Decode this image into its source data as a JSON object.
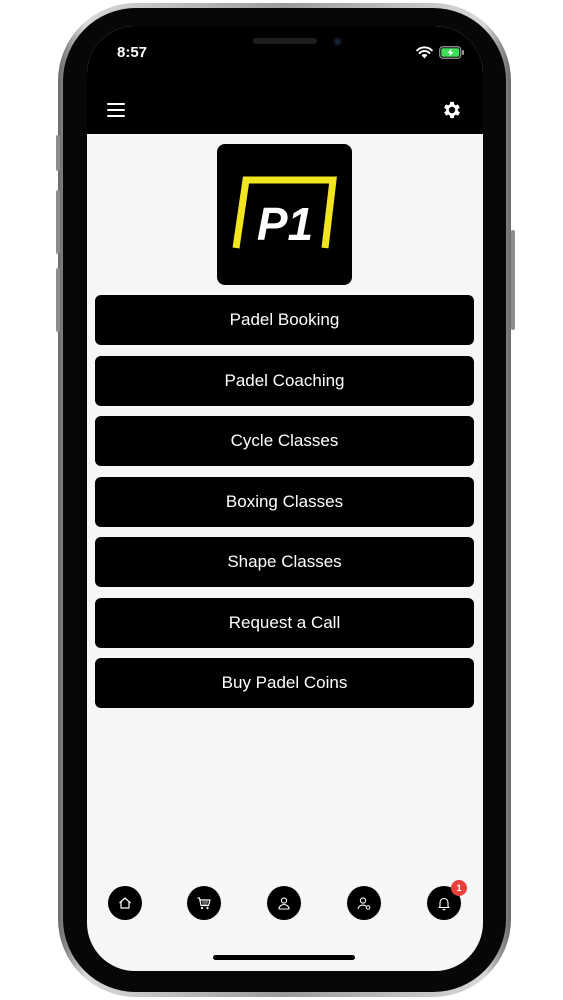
{
  "status_bar": {
    "time": "8:57",
    "icons": [
      "wifi-icon",
      "battery-charging-icon"
    ]
  },
  "header": {
    "menu_icon": "hamburger-icon",
    "settings_icon": "gear-icon"
  },
  "logo": {
    "text": "P1",
    "colors": {
      "background": "#000000",
      "accent": "#f2e51f",
      "text": "#ffffff"
    }
  },
  "menu": {
    "items": [
      {
        "label": "Padel Booking"
      },
      {
        "label": "Padel Coaching"
      },
      {
        "label": "Cycle Classes"
      },
      {
        "label": "Boxing Classes"
      },
      {
        "label": "Shape Classes"
      },
      {
        "label": "Request a Call"
      },
      {
        "label": "Buy Padel Coins"
      }
    ]
  },
  "bottom_nav": {
    "items": [
      {
        "icon": "home-icon"
      },
      {
        "icon": "cart-icon"
      },
      {
        "icon": "user-icon"
      },
      {
        "icon": "user-settings-icon"
      },
      {
        "icon": "bell-icon",
        "badge": "1"
      }
    ]
  },
  "colors": {
    "button_bg": "#000000",
    "button_text": "#ffffff",
    "screen_bg": "#f7f6f7",
    "badge": "#e5413b"
  }
}
